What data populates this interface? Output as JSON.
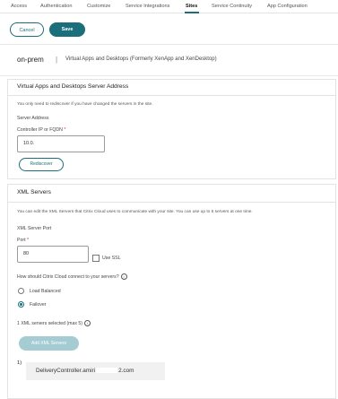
{
  "tabs": [
    {
      "label": "Access",
      "active": false
    },
    {
      "label": "Authentication",
      "active": false
    },
    {
      "label": "Customize",
      "active": false
    },
    {
      "label": "Service Integrations",
      "active": false
    },
    {
      "label": "Sites",
      "active": true
    },
    {
      "label": "Service Continuity",
      "active": false
    },
    {
      "label": "App Configuration",
      "active": false
    }
  ],
  "actions": {
    "cancel_label": "Cancel",
    "save_label": "Save"
  },
  "site": {
    "name": "on-prem",
    "separator": "|",
    "description": "Virtual Apps and Desktops (Formerly XenApp and XenDesktop)"
  },
  "server_section": {
    "title": "Virtual Apps and Desktops Server Address",
    "note": "You only need to rediscover if you have changed the servers in the site.",
    "address_label": "Server Address",
    "controller_label": "Controller IP or FQDN",
    "required_mark": "*",
    "controller_value": "10.0.",
    "rediscover_label": "Rediscover"
  },
  "xml_section": {
    "title": "XML Servers",
    "note": "You can edit the XML Servers that Citrix Cloud uses to communicate with your site. You can use up to 5 servers at one time.",
    "subtitle": "XML Server Port",
    "port_label": "Port",
    "required_mark": "*",
    "port_value": "80",
    "ssl_label": "Use SSL",
    "ssl_checked": false,
    "question": "How should Citrix Cloud connect to your servers?",
    "info_glyph": "i",
    "options": [
      {
        "label": "Load Balanced",
        "selected": false
      },
      {
        "label": "Failover",
        "selected": true
      }
    ],
    "selected_count_text": "1 XML servers selected (max 5)",
    "add_button_label": "Add XML Servers",
    "servers": [
      {
        "index": "1)",
        "prefix": "DeliveryController.amiri",
        "suffix": "2.com"
      }
    ]
  },
  "colors": {
    "accent": "#1a6f7a",
    "accent_disabled": "#a6ccd3",
    "required": "#c0392b"
  }
}
